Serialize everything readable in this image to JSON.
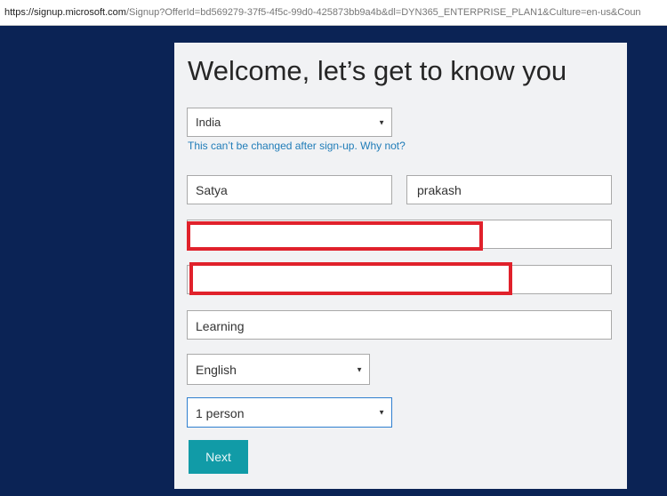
{
  "address_bar": {
    "host": "https://signup.microsoft.com",
    "path": "/Signup?OfferId=bd569279-37f5-4f5c-99d0-425873bb9a4b&dl=DYN365_ENTERPRISE_PLAN1&Culture=en-us&Coun"
  },
  "form": {
    "title": "Welcome, let’s get to know you",
    "country": {
      "value": "India"
    },
    "country_hint": "This can’t be changed after sign-up. Why not?",
    "first_name": {
      "value": "Satya"
    },
    "last_name": {
      "value": "prakash"
    },
    "organization": {
      "value": "Learning"
    },
    "language": {
      "value": "English"
    },
    "org_size": {
      "value": "1 person"
    },
    "next_label": "Next"
  },
  "colors": {
    "background": "#0b2355",
    "card": "#f1f2f4",
    "accent_button": "#119ba7",
    "link": "#1f7cb8",
    "redaction": "#e0212b"
  }
}
